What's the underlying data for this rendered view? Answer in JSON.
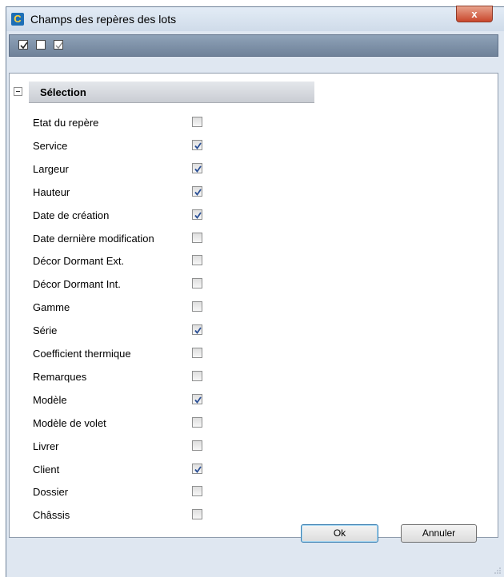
{
  "window": {
    "title": "Champs des repères des lots",
    "close_label": "x"
  },
  "toolbar": {
    "buttons": [
      {
        "name": "check-all",
        "state": "checked"
      },
      {
        "name": "uncheck-all",
        "state": "unchecked"
      },
      {
        "name": "invert",
        "state": "partial"
      }
    ]
  },
  "grid": {
    "category": "Sélection",
    "collapse_symbol": "−",
    "properties": [
      {
        "label": "Etat du repère",
        "checked": false
      },
      {
        "label": "Service",
        "checked": true
      },
      {
        "label": "Largeur",
        "checked": true
      },
      {
        "label": "Hauteur",
        "checked": true
      },
      {
        "label": "Date de création",
        "checked": true
      },
      {
        "label": "Date dernière modification",
        "checked": false
      },
      {
        "label": "Décor Dormant Ext.",
        "checked": false
      },
      {
        "label": "Décor Dormant Int.",
        "checked": false
      },
      {
        "label": "Gamme",
        "checked": false
      },
      {
        "label": "Série",
        "checked": true
      },
      {
        "label": "Coefficient thermique",
        "checked": false
      },
      {
        "label": "Remarques",
        "checked": false
      },
      {
        "label": "Modèle",
        "checked": true
      },
      {
        "label": "Modèle de volet",
        "checked": false
      },
      {
        "label": "Livrer",
        "checked": false
      },
      {
        "label": "Client",
        "checked": true
      },
      {
        "label": "Dossier",
        "checked": false
      },
      {
        "label": "Châssis",
        "checked": false
      }
    ]
  },
  "footer": {
    "ok_label": "Ok",
    "cancel_label": "Annuler"
  },
  "colors": {
    "check_mark": "#2a4f95",
    "window_bg": "#dfe7f1",
    "toolbar_bg": "#7d90a8"
  }
}
